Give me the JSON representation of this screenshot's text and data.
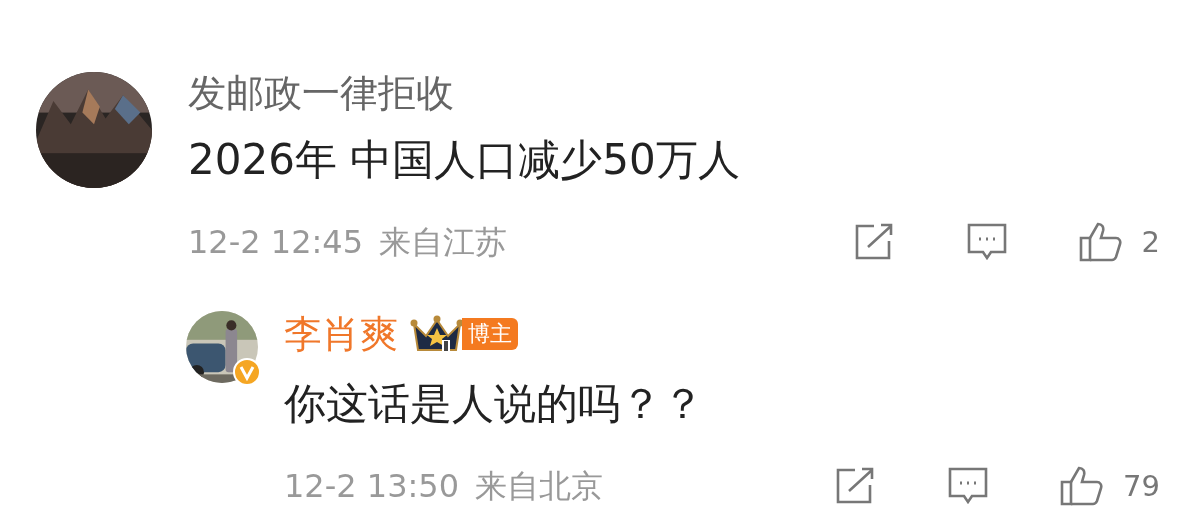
{
  "comment": {
    "name": "发邮政一律拒收",
    "author": false,
    "text": "2026年 中国人口减少50万人",
    "time": "12-2 12:45",
    "location": "来自江苏",
    "likes": "2",
    "replies": [
      {
        "name": "李肖爽",
        "author": true,
        "verified": true,
        "badge": "博主",
        "text": "你这话是人说的吗？？",
        "time": "12-2 13:50",
        "location": "来自北京",
        "likes": "79"
      }
    ]
  }
}
